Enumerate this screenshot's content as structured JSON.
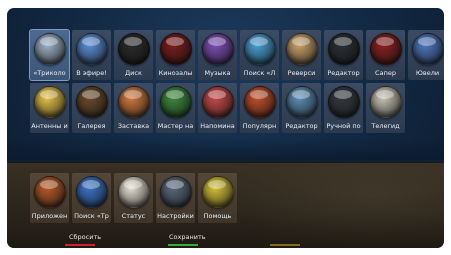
{
  "menu": {
    "row1": [
      {
        "id": "tricolor",
        "label": "«Триколо",
        "color": "#9fb3c8",
        "selected": true
      },
      {
        "id": "live",
        "label": "В эфире!",
        "color": "#5b8fd8"
      },
      {
        "id": "disk",
        "label": "Диск",
        "color": "#2a2a2a"
      },
      {
        "id": "cinema",
        "label": "Кинозалы",
        "color": "#7a1d1d"
      },
      {
        "id": "music",
        "label": "Музыка",
        "color": "#7e4fb5"
      },
      {
        "id": "search-l",
        "label": "Поиск «Л",
        "color": "#4aa0d6"
      },
      {
        "id": "reversi",
        "label": "Реверси",
        "color": "#c9a26a"
      },
      {
        "id": "editor1",
        "label": "Редактор",
        "color": "#2b2f35"
      },
      {
        "id": "saper",
        "label": "Сапер",
        "color": "#8a2020"
      },
      {
        "id": "jewels",
        "label": "Ювели",
        "color": "#4f78c2"
      }
    ],
    "row2": [
      {
        "id": "antennas",
        "label": "Антенны и",
        "color": "#e6c34a"
      },
      {
        "id": "gallery",
        "label": "Галерея",
        "color": "#6b4a2c"
      },
      {
        "id": "screensaver",
        "label": "Заставка",
        "color": "#d07a40"
      },
      {
        "id": "wizard",
        "label": "Мастер на",
        "color": "#3e8a3e"
      },
      {
        "id": "reminders",
        "label": "Напомина",
        "color": "#c94a4a"
      },
      {
        "id": "popular",
        "label": "Популярн",
        "color": "#c24f2a"
      },
      {
        "id": "editor2",
        "label": "Редактор",
        "color": "#5f8fb8"
      },
      {
        "id": "manual",
        "label": "Ручной по",
        "color": "#353a40"
      },
      {
        "id": "teletext",
        "label": "Телегид",
        "color": "#c9c4b5"
      }
    ],
    "row3": [
      {
        "id": "apps",
        "label": "Приложен",
        "color": "#b85a28"
      },
      {
        "id": "search-t",
        "label": "Поиск «Тр",
        "color": "#3c74c8"
      },
      {
        "id": "status",
        "label": "Статус",
        "color": "#e8e2d4"
      },
      {
        "id": "settings",
        "label": "Настройки",
        "color": "#5a6a7c"
      },
      {
        "id": "help",
        "label": "Помощь",
        "color": "#d6c23a"
      }
    ]
  },
  "footer": {
    "reset_label": "Сбросить",
    "reset_color": "#d0242a",
    "save_label": "Сохранить",
    "save_color": "#3aaa3e",
    "yellow_color": "#c8a52c"
  }
}
